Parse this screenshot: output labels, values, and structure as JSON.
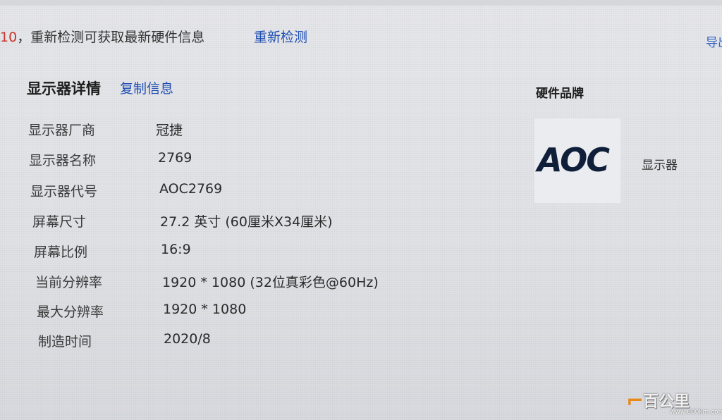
{
  "notice": {
    "count": "10",
    "text": "，重新检测可获取最新硬件信息",
    "recheck_label": "重新检测"
  },
  "nav": {
    "partial_label": "导出"
  },
  "details": {
    "title": "显示器详情",
    "copy_label": "复制信息",
    "rows": [
      {
        "label": "显示器厂商",
        "value": "冠捷"
      },
      {
        "label": "显示器名称",
        "value": "2769"
      },
      {
        "label": "显示器代号",
        "value": "AOC2769"
      },
      {
        "label": "屏幕尺寸",
        "value": "27.2 英寸 (60厘米X34厘米)"
      },
      {
        "label": "屏幕比例",
        "value": "16:9"
      },
      {
        "label": "当前分辨率",
        "value": "1920 * 1080 (32位真彩色@60Hz)"
      },
      {
        "label": "最大分辨率",
        "value": "1920 * 1080"
      },
      {
        "label": "制造时间",
        "value": "2020/8"
      }
    ]
  },
  "brand": {
    "title": "硬件品牌",
    "logo_text": "AOC",
    "type_label": "显示器"
  },
  "watermark": {
    "name": "百公里",
    "url": "www.600km.com"
  },
  "colors": {
    "link": "#1f4fb3",
    "count_red": "#c7332b",
    "logo": "#0f1f3a",
    "watermark_orange": "#e88a1a"
  }
}
